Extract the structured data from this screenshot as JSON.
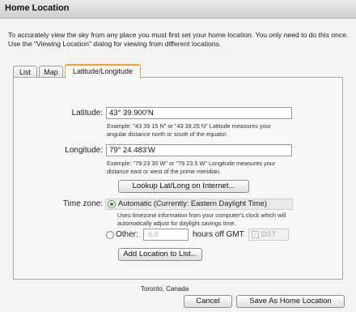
{
  "window": {
    "title": "Home Location"
  },
  "intro_text": "To accurately view the sky from any place you must first set your home location. You only need to do this once. Use the \"Viewing Location\" dialog for viewing from different locations.",
  "tabs": [
    {
      "label": "List",
      "active": false
    },
    {
      "label": "Map",
      "active": false
    },
    {
      "label": "Latitude/Longitude",
      "active": true
    }
  ],
  "latitude": {
    "label": "Latitude:",
    "value": "43° 39.900'N",
    "help": "Example: \"43 39 15 N\" or \"43 39.25 N\"  Latitude measures your angular distance north or south of the equator."
  },
  "longitude": {
    "label": "Longitude:",
    "value": "79° 24.483'W",
    "help": "Example: \"79 23 30 W\" or \"79 23.5 W\"  Longitude measures your distance east or west of the prime meridian."
  },
  "lookup_button": "Lookup Lat/Long on Internet...",
  "timezone": {
    "label": "Time zone:",
    "automatic_label": "Automatic (Currently: Eastern Daylight Time)",
    "automatic_help": "Uses timezone information from your computer's clock which will automatically adjust for daylight savings time.",
    "other_label": "Other:",
    "other_value": "-5.0",
    "hours_label": "hours off GMT",
    "dst_label": "DST",
    "selected": "automatic"
  },
  "add_location_button": "Add Location to List...",
  "location_name": "Toronto, Canada",
  "cancel_button": "Cancel",
  "save_button": "Save As Home Location",
  "colors": {
    "active_tab_border": "#e8a040",
    "radio_selected": "#3a8a2a"
  }
}
